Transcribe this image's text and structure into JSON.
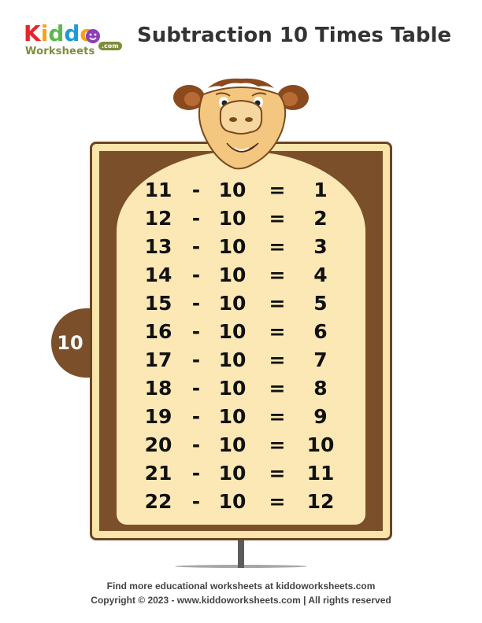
{
  "header": {
    "logo": {
      "brand_letters": [
        {
          "char": "K",
          "color": "#e8232e"
        },
        {
          "char": "i",
          "color": "#f6a21b"
        },
        {
          "char": "d",
          "color": "#5bb94b"
        },
        {
          "char": "d",
          "color": "#1e9ad7"
        },
        {
          "char": "o",
          "color": "#f6a21b"
        }
      ],
      "subtitle": "Worksheets",
      "domain_badge": ".com"
    },
    "title": "Subtraction 10 Times Table"
  },
  "table": {
    "number_tab": "10",
    "operator": "-",
    "equals": "=",
    "rows": [
      {
        "minuend": "11",
        "subtrahend": "10",
        "result": "1"
      },
      {
        "minuend": "12",
        "subtrahend": "10",
        "result": "2"
      },
      {
        "minuend": "13",
        "subtrahend": "10",
        "result": "3"
      },
      {
        "minuend": "14",
        "subtrahend": "10",
        "result": "4"
      },
      {
        "minuend": "15",
        "subtrahend": "10",
        "result": "5"
      },
      {
        "minuend": "16",
        "subtrahend": "10",
        "result": "6"
      },
      {
        "minuend": "17",
        "subtrahend": "10",
        "result": "7"
      },
      {
        "minuend": "18",
        "subtrahend": "10",
        "result": "8"
      },
      {
        "minuend": "19",
        "subtrahend": "10",
        "result": "9"
      },
      {
        "minuend": "20",
        "subtrahend": "10",
        "result": "10"
      },
      {
        "minuend": "21",
        "subtrahend": "10",
        "result": "11"
      },
      {
        "minuend": "22",
        "subtrahend": "10",
        "result": "12"
      }
    ]
  },
  "colors": {
    "board_brown": "#7a4f2a",
    "board_cream": "#fbe8b4",
    "camel_fur": "#f3c77f",
    "camel_ears": "#8a4a1e"
  },
  "footer": {
    "line1": "Find more educational worksheets at kiddoworksheets.com",
    "line2": "Copyright © 2023 - www.kiddoworksheets.com  |  All rights reserved"
  }
}
